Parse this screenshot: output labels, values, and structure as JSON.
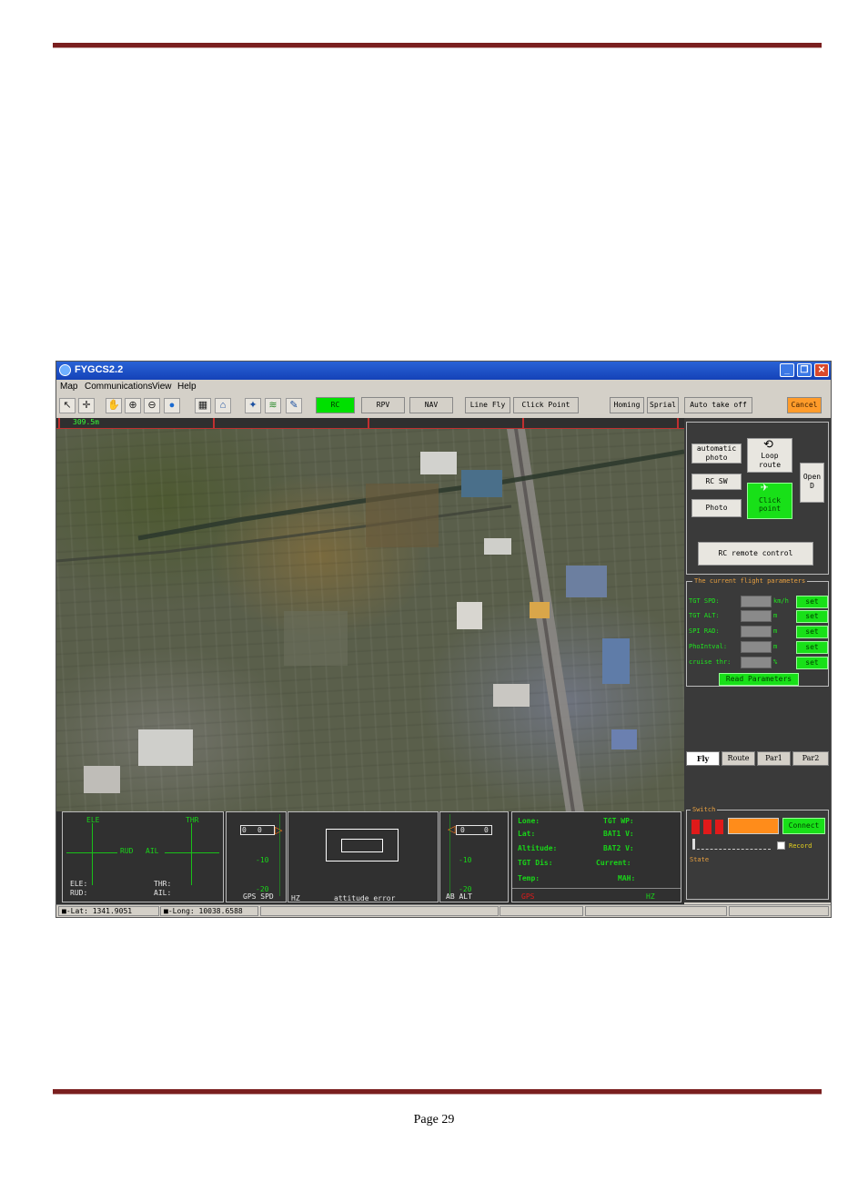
{
  "window": {
    "title": "FYGCS2.2",
    "menu": [
      "Map",
      "Communications",
      "View",
      "Help"
    ]
  },
  "toolbar": {
    "mode_buttons": [
      "RC",
      "RPV",
      "NAV"
    ],
    "action_buttons": [
      "Line Fly",
      "Click Point",
      "Homing",
      "Sprial",
      "Auto take off",
      "Cancel"
    ]
  },
  "map": {
    "scale_label": "309.5m"
  },
  "control_panel": {
    "automatic_photo": "automatic photo",
    "loop_route": "Loop route",
    "open_d": "Open D",
    "rc_sw": "RC SW",
    "click_point": "Click point",
    "photo": "Photo",
    "rc_remote_control": "RC remote control"
  },
  "flight_params": {
    "title": "The current flight parameters",
    "rows": [
      {
        "label": "TGT SPD:",
        "unit": "km/h",
        "button": "set"
      },
      {
        "label": "TGT ALT:",
        "unit": "m",
        "button": "set"
      },
      {
        "label": "SPI RAD:",
        "unit": "m",
        "button": "set"
      },
      {
        "label": "PhoIntval:",
        "unit": "m",
        "button": "set"
      },
      {
        "label": "cruise thr:",
        "unit": "%",
        "button": "set"
      }
    ],
    "read_button": "Read Parameters"
  },
  "tabs": [
    "Fly",
    "Route",
    "Par1",
    "Par2"
  ],
  "switch_panel": {
    "title": "Switch",
    "connect": "Connect",
    "record": "Record",
    "state": "State"
  },
  "sticks": {
    "ele": "ELE",
    "thr": "THR",
    "rud": "RUD",
    "ail": "AIL",
    "ele_val": "ELE:",
    "rud_val": "RUD:",
    "thr_val": "THR:",
    "ail_val": "AIL:"
  },
  "gps_gauge": {
    "value_a": "0",
    "value_b": "0",
    "tick_1": "-10",
    "tick_2": "-20",
    "label": "GPS SPD"
  },
  "attitude": {
    "label_left": "HZ",
    "label": "attitude error"
  },
  "alt_gauge": {
    "value_a": "0",
    "value_b": "0",
    "tick_1": "-10",
    "tick_2": "-20",
    "label": "AB ALT"
  },
  "telemetry": {
    "lone": "Lone:",
    "lat": "Lat:",
    "altitude": "Altitude:",
    "tgt_dis": "TGT Dis:",
    "temp": "Temp:",
    "tgt_wp": "TGT WP:",
    "bat1": "BAT1 V:",
    "bat2": "BAT2 V:",
    "current": "Current:",
    "mah": "MAH:",
    "gps": "GPS",
    "hz": "HZ"
  },
  "status": {
    "lat": "Lat: 1341.9051",
    "long": "Long: 10038.6588"
  },
  "page": {
    "footer": "Page 29"
  },
  "colors": {
    "accent_green": "#18e018",
    "accent_orange": "#ff9b2a",
    "title_blue": "#2a63d6",
    "doc_rule": "#7a1f1f"
  }
}
